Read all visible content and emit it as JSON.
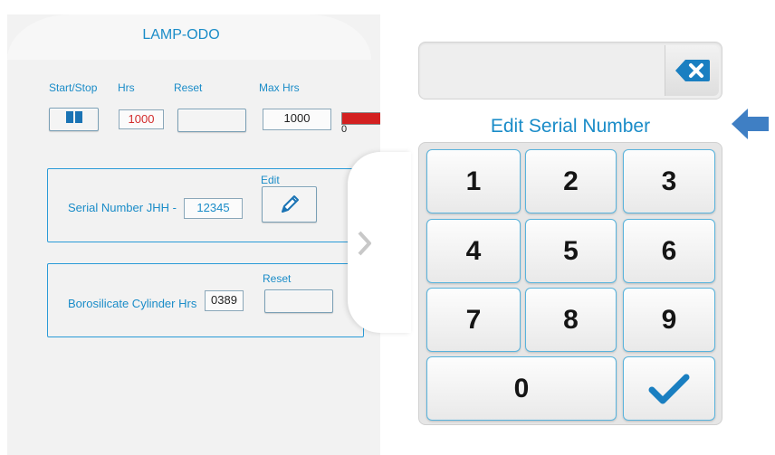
{
  "left": {
    "tab_title": "LAMP-ODO",
    "labels": {
      "start_stop": "Start/Stop",
      "hrs": "Hrs",
      "reset": "Reset",
      "max_hrs": "Max Hrs"
    },
    "hrs_value": "1000",
    "max_hrs_value": "1000",
    "gauge_zero": "0",
    "serial": {
      "label": "Serial Number JHH -",
      "value": "12345",
      "edit_label": "Edit"
    },
    "cylinder": {
      "label": "Borosilicate Cylinder Hrs",
      "value": "0389",
      "reset_label": "Reset"
    }
  },
  "keypad": {
    "title": "Edit Serial Number",
    "display_value": "",
    "keys": [
      "1",
      "2",
      "3",
      "4",
      "5",
      "6",
      "7",
      "8",
      "9",
      "0"
    ]
  },
  "colors": {
    "accent": "#1a8cc8",
    "gauge_red": "#d32020",
    "check": "#1a7fc1",
    "arrow": "#3f7fc4"
  }
}
